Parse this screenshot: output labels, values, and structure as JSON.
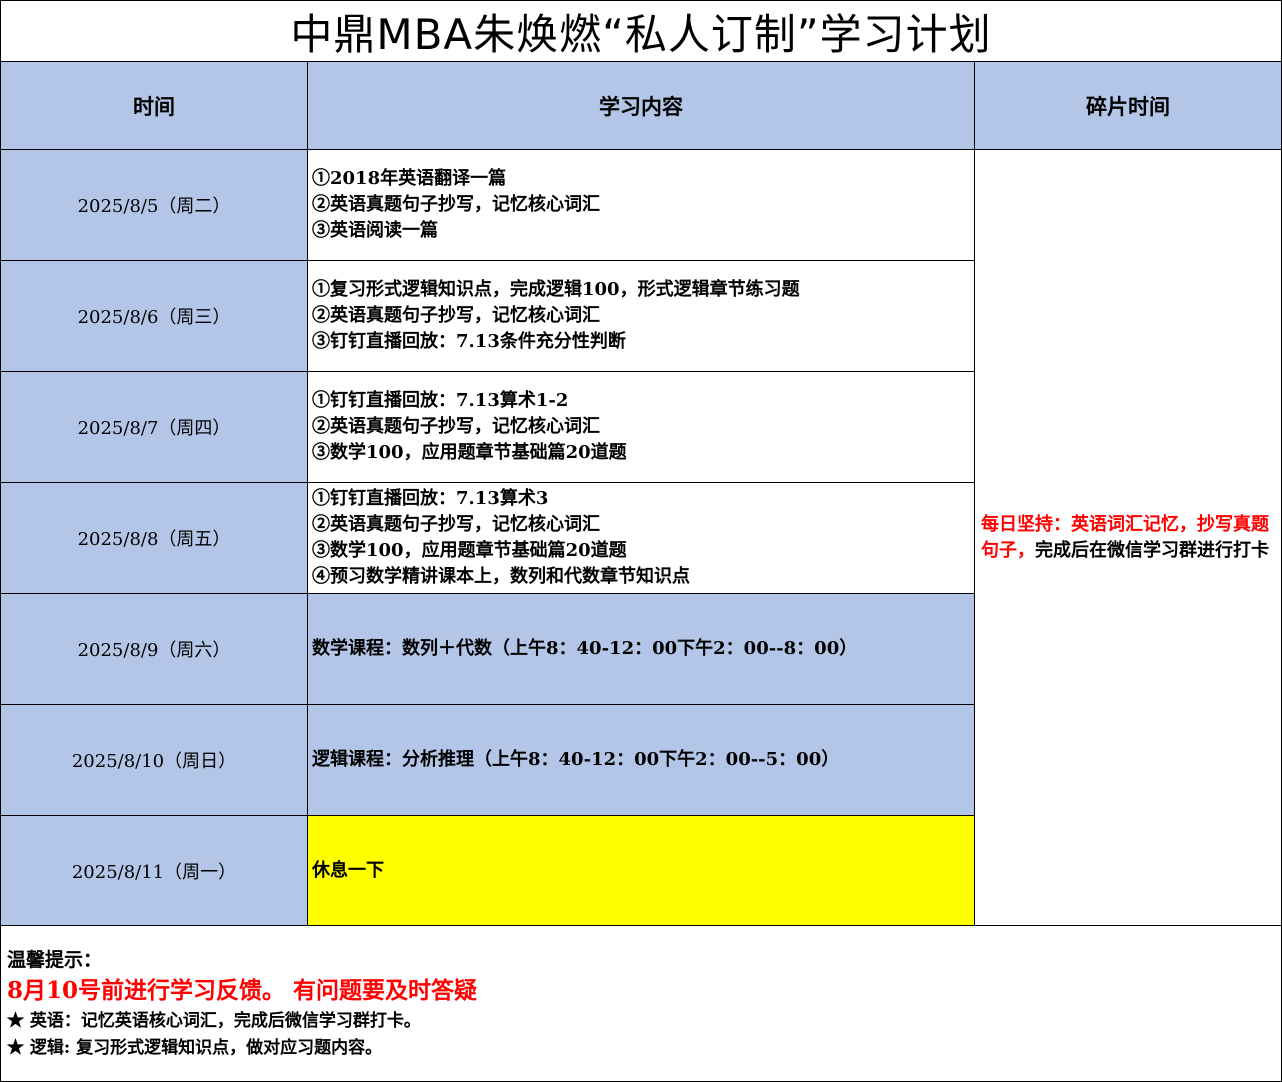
{
  "title": "中鼎MBA朱焕燃“私人订制”学习计划",
  "headers": {
    "time": "时间",
    "content": "学习内容",
    "fragment": "碎片时间"
  },
  "rows": [
    {
      "date": "2025/8/5（周二）",
      "lines": [
        "①2018年英语翻译一篇",
        "②英语真题句子抄写，记忆核心词汇",
        "③英语阅读一篇"
      ]
    },
    {
      "date": "2025/8/6（周三）",
      "lines": [
        "①复习形式逻辑知识点，完成逻辑100，形式逻辑章节练习题",
        "②英语真题句子抄写，记忆核心词汇",
        "③钉钉直播回放：7.13条件充分性判断"
      ]
    },
    {
      "date": "2025/8/7（周四）",
      "lines": [
        "①钉钉直播回放：7.13算术1-2",
        "②英语真题句子抄写，记忆核心词汇",
        "③数学100，应用题章节基础篇20道题"
      ]
    },
    {
      "date": "2025/8/8（周五）",
      "lines": [
        "①钉钉直播回放：7.13算术3",
        "②英语真题句子抄写，记忆核心词汇",
        "③数学100，应用题章节基础篇20道题",
        "④预习数学精讲课本上，数列和代数章节知识点"
      ]
    },
    {
      "date": "2025/8/9（周六）",
      "lines": [
        "数学课程：数列＋代数（上午8：40-12：00下午2：00--8：00）"
      ]
    },
    {
      "date": "2025/8/10（周日）",
      "lines": [
        "逻辑课程：分析推理（上午8：40-12：00下午2：00--5：00）"
      ]
    },
    {
      "date": "2025/8/11（周一）",
      "lines": [
        "休息一下"
      ]
    }
  ],
  "fragment": {
    "red_part": "每日坚持：英语词汇记忆，抄写真题句子，",
    "black_part": "完成后在微信学习群进行打卡"
  },
  "notes": {
    "title": "温馨提示：",
    "red_line": "8月10号前进行学习反馈。 有问题要及时答疑",
    "items": [
      "★ 英语：记忆英语核心词汇，完成后微信学习群打卡。",
      "★ 逻辑: 复习形式逻辑知识点，做对应习题内容。"
    ]
  },
  "colors": {
    "header_bg": "#b4c6e7",
    "highlight": "#ffff00",
    "accent_red": "#ff0000"
  }
}
